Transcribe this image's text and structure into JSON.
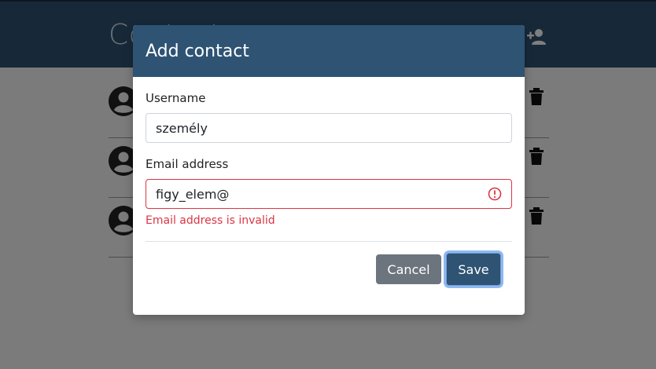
{
  "app": {
    "title": "Contacts"
  },
  "contacts": [
    {
      "id": 1
    },
    {
      "id": 2
    },
    {
      "id": 3
    }
  ],
  "modal": {
    "title": "Add contact",
    "username_label": "Username",
    "username_value": "személy",
    "email_label": "Email address",
    "email_value": "figy_elem@",
    "email_error": "Email address is invalid",
    "cancel_label": "Cancel",
    "save_label": "Save"
  },
  "colors": {
    "header": "#2e5373",
    "error": "#dc3545",
    "cancel": "#6c757d"
  },
  "icons": {
    "add_person": "person-add-icon",
    "avatar": "account-circle-icon",
    "delete": "trash-icon",
    "invalid": "error-circle-icon"
  }
}
